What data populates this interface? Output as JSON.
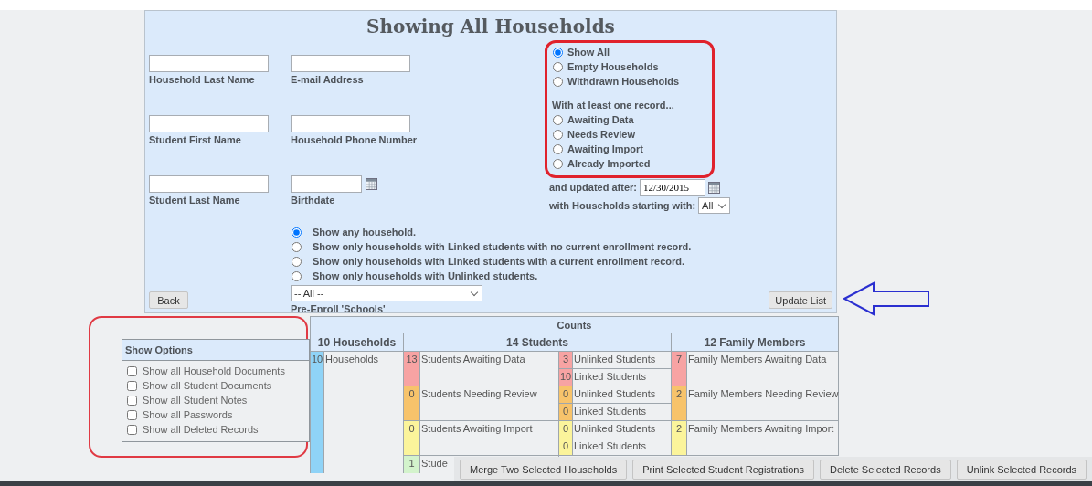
{
  "title": "Showing All Households",
  "fields": [
    {
      "label": "Household Last Name",
      "kind": "text"
    },
    {
      "label": "E-mail Address",
      "kind": "text"
    },
    {
      "label": "Student First Name",
      "kind": "text"
    },
    {
      "label": "Household Phone Number",
      "kind": "text"
    },
    {
      "label": "Student Last Name",
      "kind": "text"
    },
    {
      "label": "Birthdate",
      "kind": "date"
    }
  ],
  "status_filter": {
    "options": [
      {
        "label": "Show All",
        "selected": true
      },
      {
        "label": "Empty Households",
        "selected": false
      },
      {
        "label": "Withdrawn Households",
        "selected": false
      }
    ],
    "record_heading": "With at least one record...",
    "record_options": [
      {
        "label": "Awaiting Data",
        "selected": false
      },
      {
        "label": "Needs Review",
        "selected": false
      },
      {
        "label": "Awaiting Import",
        "selected": false
      },
      {
        "label": "Already Imported",
        "selected": false
      }
    ]
  },
  "updated_after": {
    "label": "and updated after:",
    "value": "12/30/2015"
  },
  "starting_with": {
    "label": "with Households starting with:",
    "value": "All"
  },
  "household_filter": [
    {
      "label": "Show any household.",
      "selected": true
    },
    {
      "label": "Show only households with Linked students with no current enrollment record.",
      "selected": false
    },
    {
      "label": "Show only households with Linked students with a current enrollment record.",
      "selected": false
    },
    {
      "label": "Show only households with Unlinked students.",
      "selected": false
    }
  ],
  "back_button": "Back",
  "schools": {
    "value": "-- All --",
    "label": "Pre-Enroll 'Schools'"
  },
  "update_button": "Update List",
  "show_options": {
    "title": "Show Options",
    "items": [
      {
        "label": "Show all Household Documents",
        "checked": false
      },
      {
        "label": "Show all Student Documents",
        "checked": false
      },
      {
        "label": "Show all Student Notes",
        "checked": false
      },
      {
        "label": "Show all Passwords",
        "checked": false
      },
      {
        "label": "Show all Deleted Records",
        "checked": false
      }
    ]
  },
  "counts": {
    "title": "Counts",
    "groups": [
      "10 Households",
      "14 Students",
      "12 Family Members"
    ],
    "households": {
      "count": "10",
      "label": "Households",
      "color": "#8fd3f7"
    },
    "rows": [
      {
        "color": "#f7a3a3",
        "count": "13",
        "label": "Students Awaiting Data",
        "sub": [
          {
            "count": "3",
            "label": "Unlinked Students"
          },
          {
            "count": "10",
            "label": "Linked Students"
          }
        ],
        "family": {
          "count": "7",
          "label": "Family Members Awaiting Data"
        }
      },
      {
        "color": "#f7c36b",
        "count": "0",
        "label": "Students Needing Review",
        "sub": [
          {
            "count": "0",
            "label": "Unlinked Students"
          },
          {
            "count": "0",
            "label": "Linked Students"
          }
        ],
        "family": {
          "count": "2",
          "label": "Family Members Needing Review"
        }
      },
      {
        "color": "#fbf49b",
        "count": "0",
        "label": "Students Awaiting Import",
        "sub": [
          {
            "count": "0",
            "label": "Unlinked Students"
          },
          {
            "count": "0",
            "label": "Linked Students"
          }
        ],
        "family": {
          "count": "2",
          "label": "Family Members Awaiting Import"
        }
      },
      {
        "color": "#d3f3cc",
        "count": "1",
        "label": "Stude"
      }
    ]
  },
  "actions": [
    "Merge Two Selected Households",
    "Print Selected Student Registrations",
    "Delete Selected Records",
    "Unlink Selected Records"
  ]
}
